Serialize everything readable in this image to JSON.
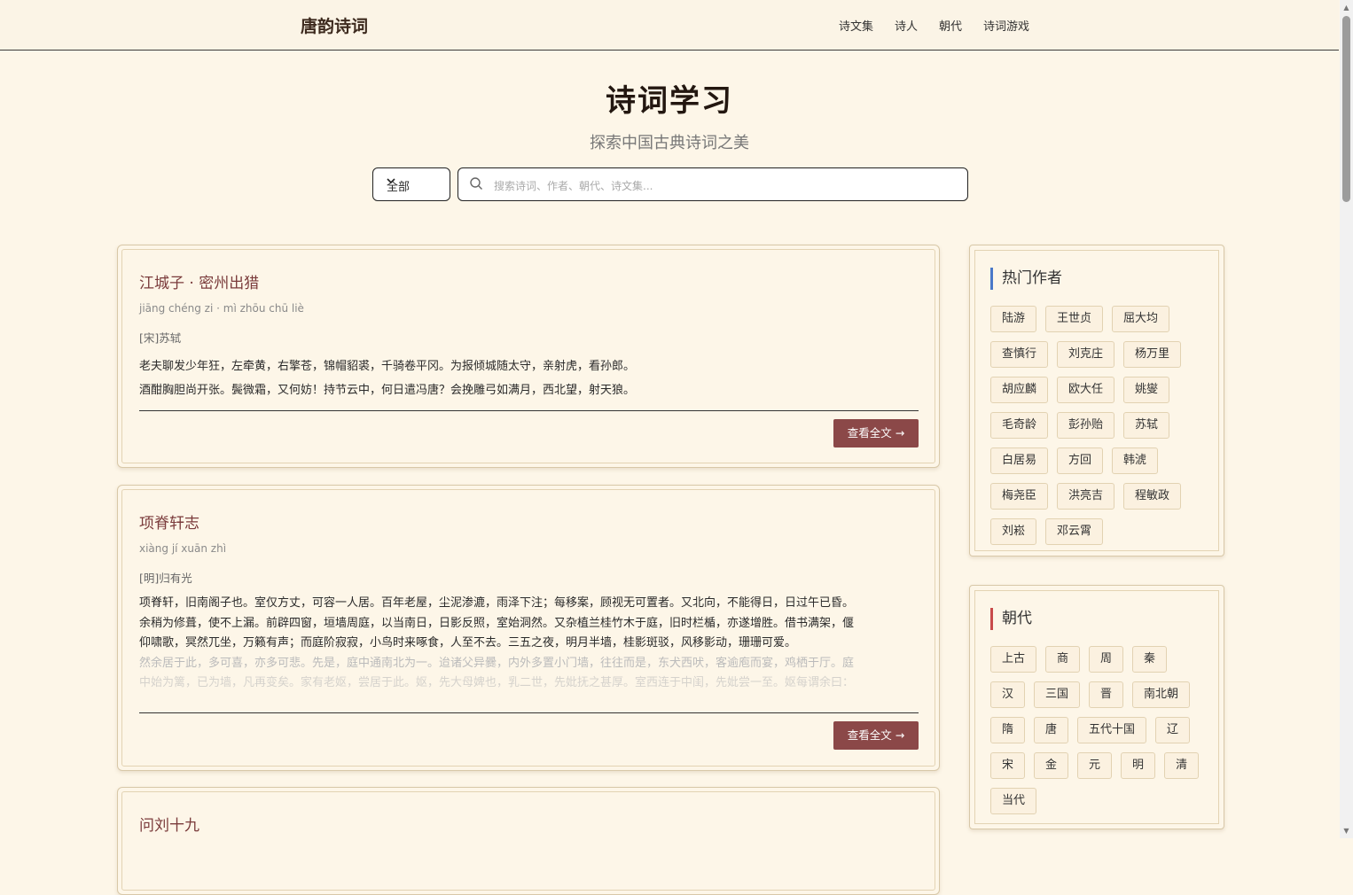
{
  "header": {
    "brand": "唐韵诗词",
    "nav": [
      "诗文集",
      "诗人",
      "朝代",
      "诗词游戏"
    ]
  },
  "hero": {
    "title": "诗词学习",
    "subtitle": "探索中国古典诗词之美"
  },
  "search": {
    "filter_value": "全部",
    "placeholder": "搜索诗词、作者、朝代、诗文集..."
  },
  "cards": [
    {
      "title": "江城子 · 密州出猎",
      "pinyin": "jiāng chéng zi · mì zhōu chū liè",
      "author": "[宋]苏轼",
      "lines": [
        "老夫聊发少年狂，左牵黄，右擎苍，锦帽貂裘，千骑卷平冈。为报倾城随太守，亲射虎，看孙郎。",
        "酒酣胸胆尚开张。鬓微霜，又何妨！持节云中，何日遣冯唐？会挽雕弓如满月，西北望，射天狼。"
      ],
      "faded": [],
      "button": "查看全文 →"
    },
    {
      "title": "项脊轩志",
      "pinyin": "xiàng jí xuān zhì",
      "author": "[明]归有光",
      "lines": [
        "项脊轩，旧南阁子也。室仅方丈，可容一人居。百年老屋，尘泥渗漉，雨泽下注；每移案，顾视无可置者。又北向，不能得日，日过午已昏。",
        "余稍为修葺，使不上漏。前辟四窗，垣墙周庭，以当南日，日影反照，室始洞然。又杂植兰桂竹木于庭，旧时栏楯，亦遂增胜。借书满架，偃",
        "仰啸歌，冥然兀坐，万籁有声；而庭阶寂寂，小鸟时来啄食，人至不去。三五之夜，明月半墙，桂影斑驳，风移影动，珊珊可爱。"
      ],
      "faded": [
        "然余居于此，多可喜，亦多可悲。先是，庭中通南北为一。迨诸父异爨，内外多置小门墙，往往而是，东犬西吠，客逾庖而宴，鸡栖于厅。庭",
        "中始为篱，已为墙，凡再变矣。家有老妪，尝居于此。妪，先大母婢也，乳二世，先妣抚之甚厚。室西连于中闺，先妣尝一至。妪每谓余曰："
      ],
      "button": "查看全文 →"
    },
    {
      "title": "问刘十九",
      "pinyin": "",
      "author": "",
      "lines": [],
      "faded": [],
      "button": ""
    }
  ],
  "hot_authors": {
    "title": "热门作者",
    "items": [
      "陆游",
      "王世贞",
      "屈大均",
      "查慎行",
      "刘克庄",
      "杨万里",
      "胡应麟",
      "欧大任",
      "姚燮",
      "毛奇龄",
      "彭孙贻",
      "苏轼",
      "白居易",
      "方回",
      "韩淲",
      "梅尧臣",
      "洪亮吉",
      "程敏政",
      "刘崧",
      "邓云霄"
    ]
  },
  "dynasties": {
    "title": "朝代",
    "items": [
      "上古",
      "商",
      "周",
      "秦",
      "汉",
      "三国",
      "晋",
      "南北朝",
      "隋",
      "唐",
      "五代十国",
      "辽",
      "宋",
      "金",
      "元",
      "明",
      "清",
      "当代"
    ]
  },
  "colors": {
    "accent": "#8b4848",
    "background": "#fdf6e8",
    "title_red": "#7a3b3b",
    "authors_bar": "#4a78c8",
    "dynasty_bar": "#c84a4a"
  },
  "icons": [
    "search-icon",
    "chevron-down-icon"
  ]
}
